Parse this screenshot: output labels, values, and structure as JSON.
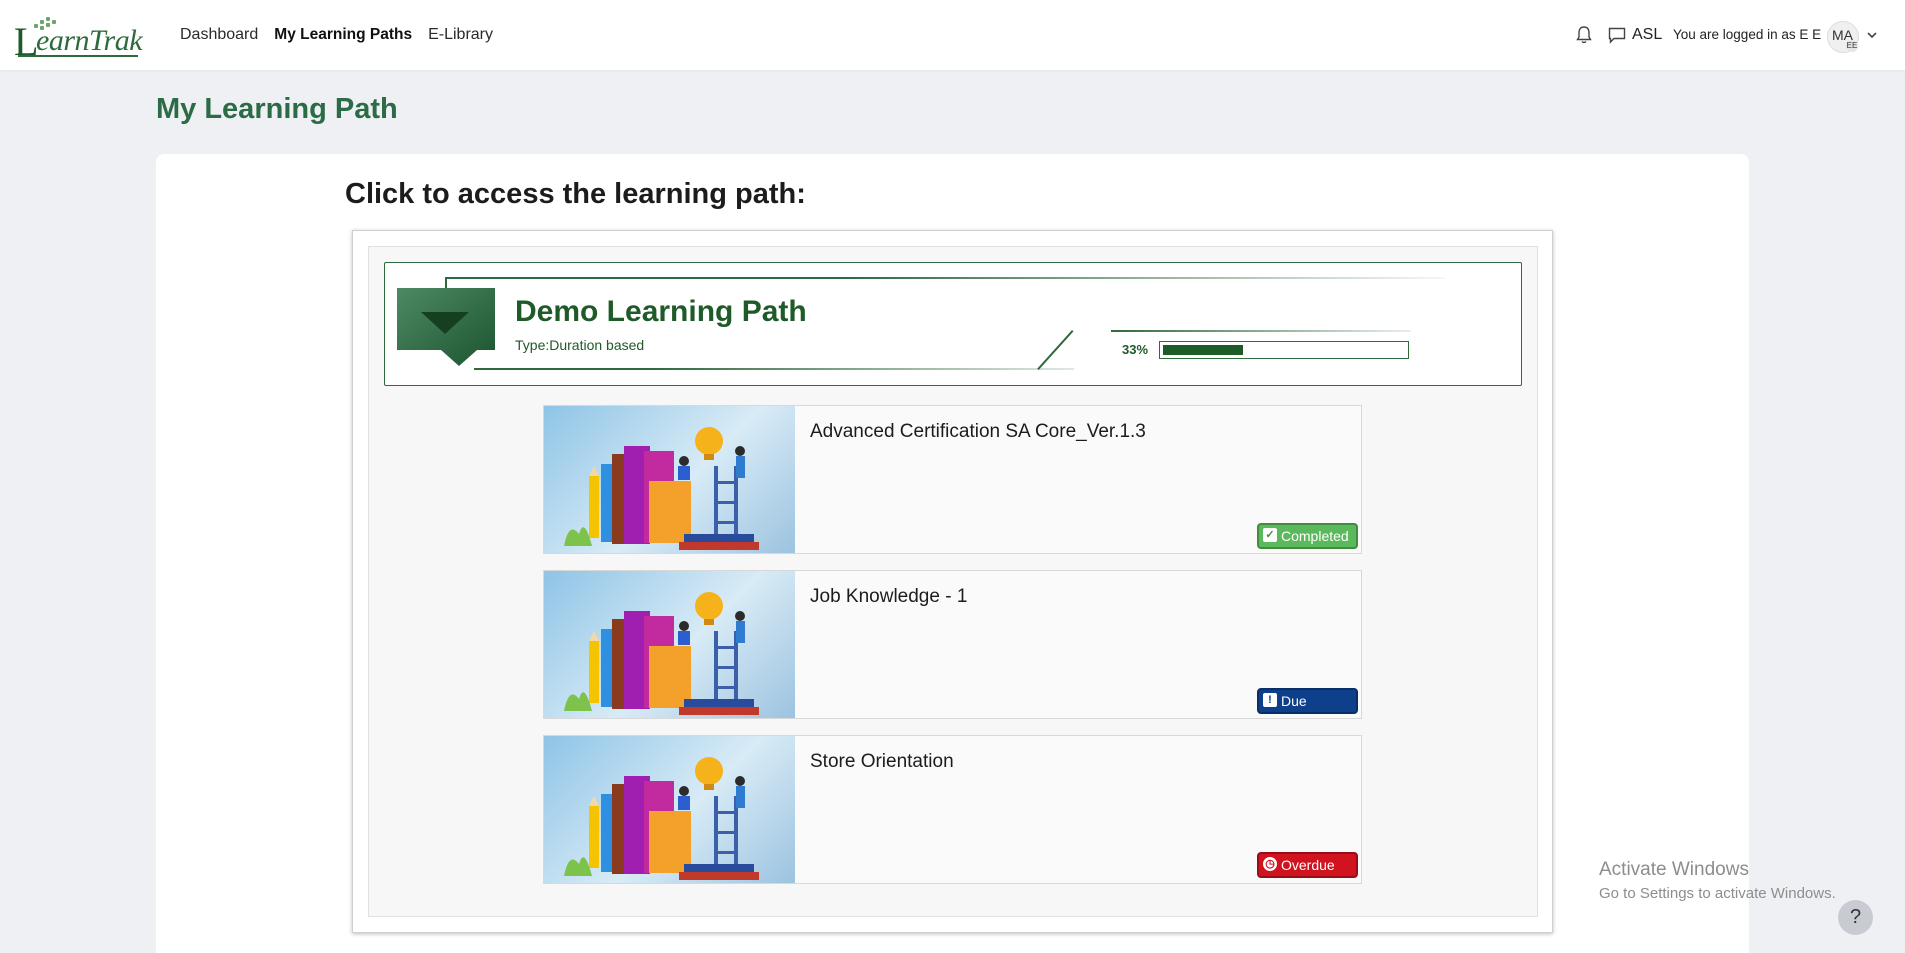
{
  "app": {
    "logo_text": "LearnTrak",
    "logo_L": "L",
    "logo_rest": "earnTrak"
  },
  "nav": {
    "items": [
      {
        "label": "Dashboard",
        "active": false
      },
      {
        "label": "My Learning Paths",
        "active": true
      },
      {
        "label": "E-Library",
        "active": false
      }
    ]
  },
  "header_right": {
    "notifications_icon": "bell-icon",
    "messages_icon": "chat-icon",
    "org": "ASL",
    "logged_in_text": "You are logged in as E E",
    "avatar_initials": "MA",
    "avatar_sub": "EE"
  },
  "page": {
    "title": "My Learning Path",
    "subtitle": "Click to access the learning path:"
  },
  "learning_path": {
    "title": "Demo Learning Path",
    "type_label": "Type:Duration based",
    "progress_label": "33%",
    "progress": 0.33,
    "accent_color": "#1f5b28"
  },
  "courses": [
    {
      "title": "Advanced Certification SA Core_Ver.1.3",
      "status": "Completed",
      "status_color": "#5cb85c"
    },
    {
      "title": "Job Knowledge - 1",
      "status": "Due",
      "status_color": "#0d3f8a"
    },
    {
      "title": "Store Orientation",
      "status": "Overdue",
      "status_color": "#d1121f"
    }
  ],
  "watermark": {
    "line1": "Activate Windows",
    "line2": "Go to Settings to activate Windows."
  },
  "help": {
    "label": "?"
  }
}
